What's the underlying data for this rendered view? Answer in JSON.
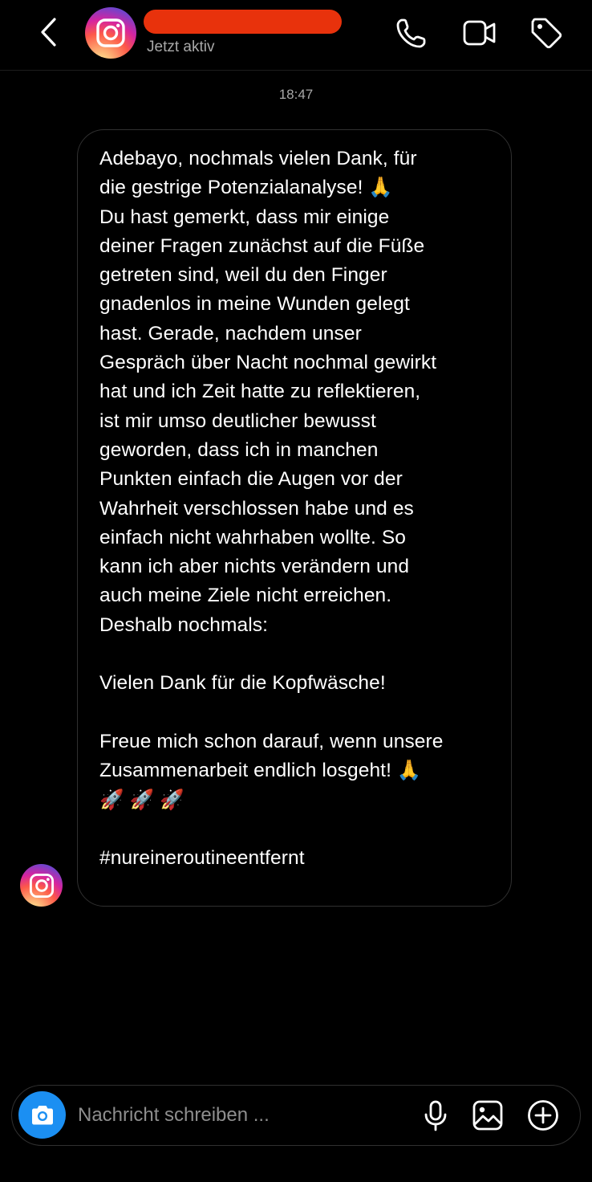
{
  "header": {
    "status": "Jetzt aktiv",
    "redaction_color": "#e8320c",
    "icons": {
      "back": "chevron-left-icon",
      "avatar": "instagram-logo",
      "call": "phone-icon",
      "video": "video-camera-icon",
      "tag": "tag-icon"
    }
  },
  "thread": {
    "timestamp": "18:47",
    "messages": [
      {
        "text": "Adebayo, nochmals vielen Dank, für\ndie gestrige Potenzialanalyse! 🙏\nDu hast gemerkt, dass mir einige\ndeiner Fragen zunächst auf die Füße\ngetreten sind, weil du den Finger\ngnadenlos in meine Wunden gelegt\nhast. Gerade, nachdem unser\nGespräch über Nacht nochmal gewirkt\nhat und ich Zeit hatte zu reflektieren,\nist mir umso deutlicher bewusst\ngeworden, dass ich in manchen\nPunkten einfach die Augen vor der\nWahrheit verschlossen habe und es\neinfach nicht wahrhaben wollte. So\nkann ich aber nichts verändern und\nauch meine Ziele nicht erreichen.\nDeshalb nochmals:\n\nVielen Dank für die Kopfwäsche!\n\nFreue mich schon darauf, wenn unsere\nZusammenarbeit endlich losgeht! 🙏\n🚀 🚀 🚀\n\n#nureineroutineentfernt"
      }
    ]
  },
  "composer": {
    "placeholder": "Nachricht schreiben ...",
    "value": "",
    "camera_color": "#1b8ff2",
    "icons": {
      "camera": "camera-icon",
      "mic": "microphone-icon",
      "gallery": "image-icon",
      "plus": "plus-circle-icon"
    }
  }
}
